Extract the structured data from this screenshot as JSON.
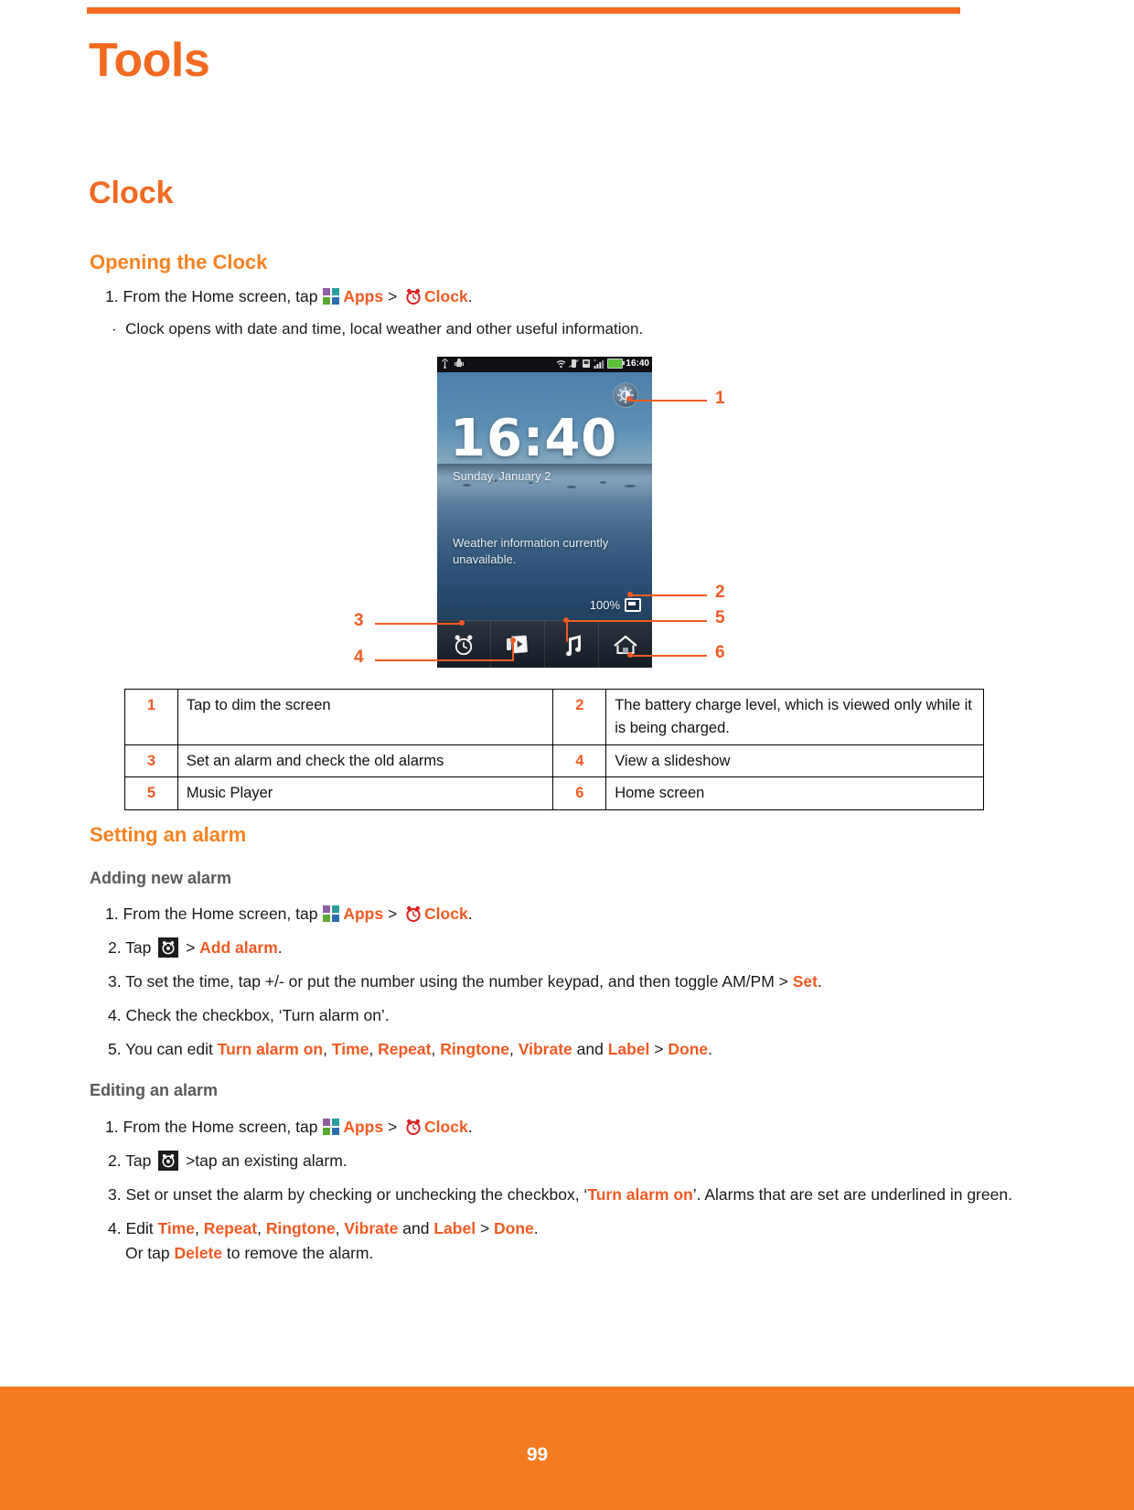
{
  "document": {
    "top_rule_color": "#f26a21",
    "chapter_title": "Tools",
    "section_title": "Clock",
    "page_number": "99"
  },
  "opening": {
    "heading": "Opening the Clock",
    "step1_prefix": "1. From the Home screen, tap ",
    "apps_label": "Apps",
    "separator": " > ",
    "clock_label": "Clock",
    "period": ".",
    "bullet": "Clock opens with date and time, local weather and other useful information."
  },
  "phone": {
    "status": {
      "usb_icon": "usb-icon",
      "android_icon": "android-robot-icon",
      "wifi_icon": "wifi-icon",
      "vibrate_icon": "vibrate-icon",
      "sdcard_icon": "sd-card-icon",
      "signal_icon": "signal-bars-icon",
      "battery_icon": "battery-icon",
      "time": "16:40"
    },
    "dim_button": "dim-screen-icon",
    "clock_time": "16:40",
    "date": "Sunday, January 2",
    "weather": "Weather information currently unavailable.",
    "battery_percent": "100%",
    "dock": [
      {
        "name": "alarm-icon",
        "label": "Alarm"
      },
      {
        "name": "slideshow-icon",
        "label": "Slideshow"
      },
      {
        "name": "music-note-icon",
        "label": "Music"
      },
      {
        "name": "home-icon",
        "label": "Home"
      }
    ]
  },
  "callouts": {
    "c1": "1",
    "c2": "2",
    "c3": "3",
    "c4": "4",
    "c5": "5",
    "c6": "6"
  },
  "legend_table": {
    "rows": [
      {
        "left_num": "1",
        "left_text": "Tap to dim the screen",
        "right_num": "2",
        "right_text": "The battery charge level, which is viewed only while it is being charged."
      },
      {
        "left_num": "3",
        "left_text": "Set an alarm and check the old alarms",
        "right_num": "4",
        "right_text": "View a slideshow"
      },
      {
        "left_num": "5",
        "left_text": "Music Player",
        "right_num": "6",
        "right_text": "Home screen"
      }
    ]
  },
  "setting_alarm": {
    "heading": "Setting an alarm",
    "adding": {
      "heading": "Adding new alarm",
      "step1_prefix": "1. From the Home screen, tap ",
      "apps_label": "Apps",
      "separator": " > ",
      "clock_label": "Clock",
      "period": ".",
      "step2_prefix": "2. Tap ",
      "step2_sep": " > ",
      "step2_link": "Add alarm",
      "step2_period": ".",
      "step3_text": "3. To set the time, tap +/- or put the number using the number keypad, and then toggle AM/PM > ",
      "step3_link": "Set",
      "step3_period": ".",
      "step4_text": "4. Check the checkbox, ‘Turn alarm on’.",
      "step5_prefix": "5. You can edit ",
      "step5_links": [
        "Turn alarm on",
        "Time",
        "Repeat",
        "Ringtone",
        "Vibrate"
      ],
      "step5_and": " and ",
      "step5_label": "Label",
      "step5_sep": " > ",
      "step5_done": "Done",
      "step5_period": "."
    },
    "editing": {
      "heading": "Editing an alarm",
      "step1_prefix": "1. From the Home screen, tap ",
      "apps_label": "Apps",
      "separator": " > ",
      "clock_label": "Clock",
      "period": ".",
      "step2_prefix": "2. Tap ",
      "step2_suffix": " >tap an existing alarm.",
      "step3_prefix": "3. Set or unset the alarm by checking or unchecking the checkbox, ‘",
      "step3_link": "Turn alarm on",
      "step3_suffix": "’.  Alarms that are set are underlined in green.",
      "step4_prefix": "4. Edit ",
      "step4_links": [
        "Time",
        "Repeat",
        "Ringtone",
        "Vibrate"
      ],
      "step4_and": " and ",
      "step4_label": "Label",
      "step4_sep": " >  ",
      "step4_done": "Done",
      "step4_period": ".",
      "step4_line2_prefix": "Or tap ",
      "step4_line2_link": "Delete",
      "step4_line2_suffix": " to remove the alarm."
    }
  }
}
